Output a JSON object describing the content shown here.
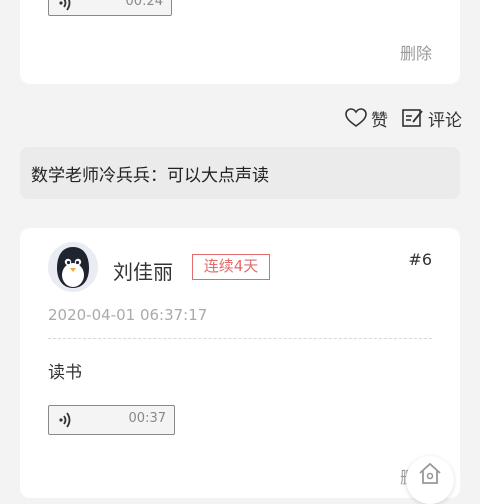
{
  "top_card": {
    "audio_duration": "00:24",
    "delete_label": "删除"
  },
  "actions": {
    "like_label": "赞",
    "comment_label": "评论"
  },
  "comment": {
    "text": "数学老师冷兵兵：可以大点声读"
  },
  "post": {
    "author_name": "刘佳丽",
    "streak_badge": "连续4天",
    "post_number": "#6",
    "timestamp": "2020-04-01 06:37:17",
    "content": "读书",
    "audio_duration": "00:37",
    "delete_label": "删除"
  },
  "colors": {
    "accent_red": "#e26b6b",
    "muted": "#9a9a9a",
    "background": "#f3f3f3"
  },
  "icons": [
    "sound-wave-icon",
    "heart-icon",
    "comment-edit-icon",
    "penguin-avatar",
    "home-icon"
  ]
}
